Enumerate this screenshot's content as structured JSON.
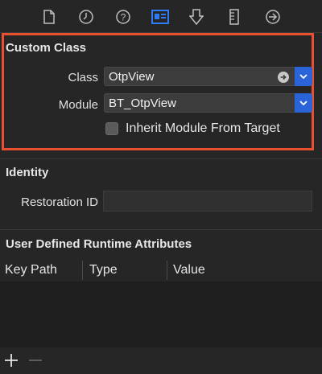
{
  "toolbar": {
    "icons": [
      "file-icon",
      "clock-icon",
      "help-icon",
      "identity-icon",
      "attributes-icon",
      "ruler-icon",
      "connections-icon"
    ],
    "active_color": "#2f7bf5"
  },
  "custom_class": {
    "title": "Custom Class",
    "class_label": "Class",
    "class_value": "OtpView",
    "module_label": "Module",
    "module_value": "BT_OtpView",
    "inherit_label": "Inherit Module From Target",
    "inherit_checked": false,
    "highlight_color": "#e8502f"
  },
  "identity": {
    "title": "Identity",
    "restoration_label": "Restoration ID",
    "restoration_value": ""
  },
  "runtime_attributes": {
    "title": "User Defined Runtime Attributes",
    "columns": [
      "Key Path",
      "Type",
      "Value"
    ],
    "rows": []
  },
  "footer": {
    "add_symbol": "+",
    "remove_symbol": "−"
  }
}
